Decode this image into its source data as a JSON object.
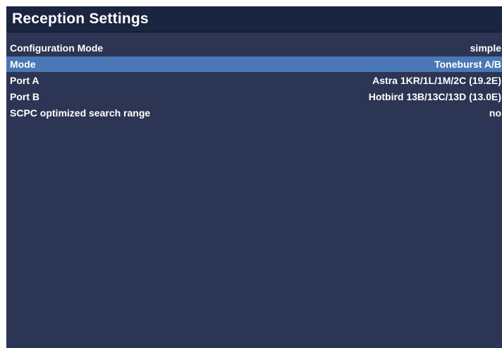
{
  "window": {
    "title": "Reception Settings"
  },
  "settings": [
    {
      "label": "Configuration Mode",
      "value": "simple",
      "selected": false
    },
    {
      "label": "Mode",
      "value": "Toneburst A/B",
      "selected": true
    },
    {
      "label": "Port A",
      "value": "Astra 1KR/1L/1M/2C (19.2E)",
      "selected": false
    },
    {
      "label": "Port B",
      "value": "Hotbird 13B/13C/13D (13.0E)",
      "selected": false
    },
    {
      "label": "SCPC optimized search range",
      "value": "no",
      "selected": false
    }
  ],
  "colors": {
    "background": "#2c3553",
    "title_bar": "#1a2540",
    "selection": "#4a77b6",
    "text": "#ffffff"
  }
}
